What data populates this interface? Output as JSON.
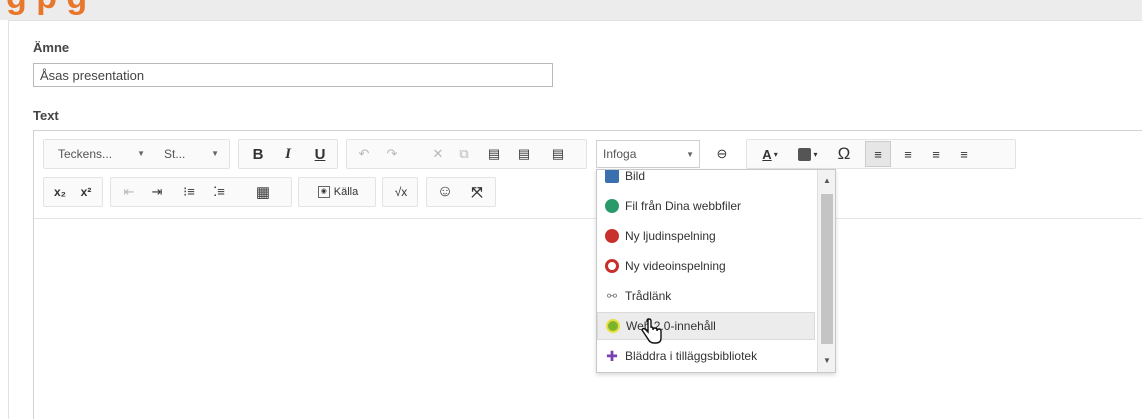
{
  "page_heading_fragment": "g   p         g",
  "subject": {
    "label": "Ämne",
    "value": "Åsas presentation"
  },
  "text_label": "Text",
  "toolbar": {
    "font_family": "Teckens...",
    "font_size": "St...",
    "bold": "B",
    "italic": "I",
    "underline": "U",
    "infoga": "Infoga",
    "text_color": "A",
    "omega": "Ω",
    "subscript": "x₂",
    "superscript": "x²",
    "source": "Källa"
  },
  "insert_menu": {
    "items": [
      {
        "label": "Bild",
        "icon": "image-icon",
        "color": "#3a6fb0"
      },
      {
        "label": "Fil från Dina webbfiler",
        "icon": "globe-icon",
        "color": "#2a9a6a"
      },
      {
        "label": "Ny ljudinspelning",
        "icon": "microphone-icon",
        "color": "#c9302c"
      },
      {
        "label": "Ny videoinspelning",
        "icon": "video-record-icon",
        "color": "#c9302c"
      },
      {
        "label": "Trådlänk",
        "icon": "link-icon",
        "color": "#777777"
      },
      {
        "label": "Web 2.0-innehåll",
        "icon": "web20-icon",
        "color": "#7cb32a"
      },
      {
        "label": "Bläddra i tilläggsbibliotek",
        "icon": "puzzle-icon",
        "color": "#7a3fb0"
      }
    ]
  },
  "colors": {
    "accent_orange": "#e8762b",
    "hover_bg": "#ececec"
  }
}
